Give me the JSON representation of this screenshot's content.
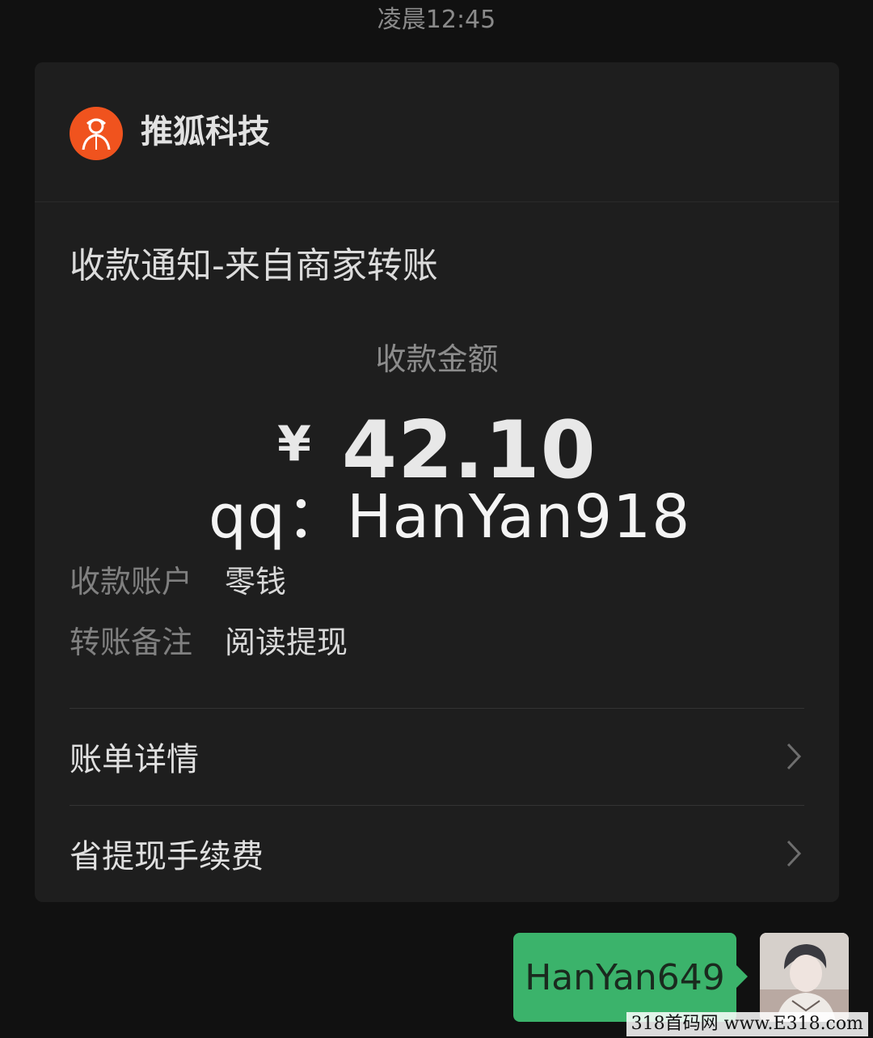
{
  "chat": {
    "timestamp": "凌晨12:45"
  },
  "card": {
    "merchant_name": "推狐科技",
    "merchant_logo_icon": "person-avatar-icon",
    "accent_color": "#f0531e",
    "title": "收款通知-来自商家转账",
    "amount_label": "收款金额",
    "currency_symbol": "¥",
    "amount": "42.10",
    "overlay_text": "qq：HanYan918",
    "details": [
      {
        "key": "收款账户",
        "value": "零钱"
      },
      {
        "key": "转账备注",
        "value": "阅读提现"
      }
    ],
    "links": [
      {
        "label": "账单详情",
        "icon": "chevron-right-icon"
      },
      {
        "label": "省提现手续费",
        "icon": "chevron-right-icon"
      }
    ]
  },
  "message": {
    "text": "HanYan649",
    "bubble_color": "#3bb36b"
  },
  "site_watermark": "318首码网 www.E318.com"
}
